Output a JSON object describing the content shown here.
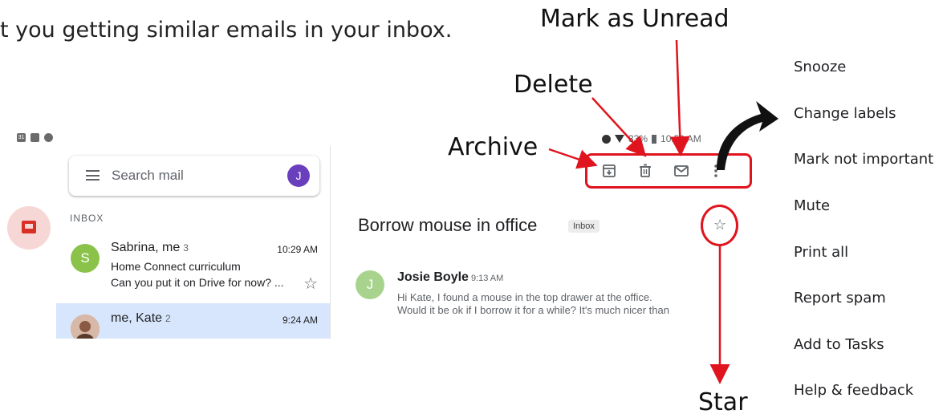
{
  "intro_text": "t you getting similar emails in your inbox.",
  "callouts": {
    "mark_unread": "Mark as Unread",
    "delete": "Delete",
    "archive": "Archive",
    "star": "Star"
  },
  "status_bar": {
    "battery": "33%",
    "time": "10:59 AM"
  },
  "search": {
    "placeholder": "Search mail",
    "avatar_letter": "J"
  },
  "list": {
    "section_label": "INBOX",
    "emails": [
      {
        "avatar_letter": "S",
        "sender": "Sabrina, me",
        "count": "3",
        "time": "10:29 AM",
        "subject": "Home Connect curriculum",
        "snippet": "Can you put it on Drive for now? ..."
      },
      {
        "sender": "me, Kate",
        "count": "2",
        "time": "9:24 AM"
      }
    ]
  },
  "message": {
    "subject": "Borrow mouse in office",
    "label_chip": "Inbox",
    "avatar_letter": "J",
    "sender": "Josie Boyle",
    "time": "9:13 AM",
    "body_line1": "Hi Kate, I found a mouse in the top drawer at the office.",
    "body_line2": "Would it be ok if I borrow it for a while? It's much nicer than"
  },
  "overflow_menu": [
    "Snooze",
    "Change labels",
    "Mark not important",
    "Mute",
    "Print all",
    "Report spam",
    "Add to Tasks",
    "Help & feedback"
  ],
  "colors": {
    "annotation_red": "#e0141e",
    "selected_row": "#d7e6fc",
    "compose_fab": "#f7d6d6"
  }
}
